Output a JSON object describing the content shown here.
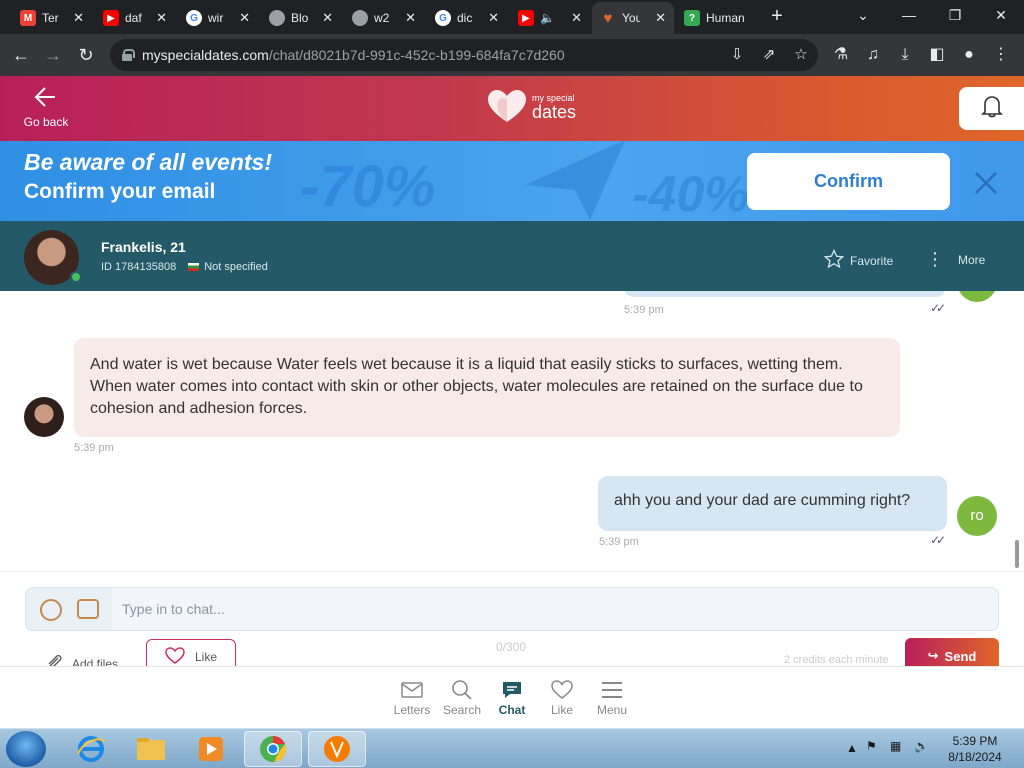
{
  "browser": {
    "tabs": [
      {
        "title": "Ter",
        "icon": "mail-icon",
        "color": "#ea4335"
      },
      {
        "title": "daf",
        "icon": "youtube-icon",
        "color": "#ff0000"
      },
      {
        "title": "wir",
        "icon": "google-icon",
        "color": "#4285f4"
      },
      {
        "title": "Blo",
        "icon": "globe-icon",
        "color": "#9aa0a6"
      },
      {
        "title": "w2",
        "icon": "globe-icon",
        "color": "#9aa0a6"
      },
      {
        "title": "dic",
        "icon": "google-icon",
        "color": "#4285f4"
      },
      {
        "title": "",
        "icon": "youtube-icon",
        "color": "#ff0000"
      },
      {
        "title": "You",
        "icon": "heart-icon",
        "color": "#e0662a"
      },
      {
        "title": "Human",
        "icon": "question-icon",
        "color": "#34a853"
      }
    ],
    "active_tab_index": 7,
    "url_domain": "myspecialdates.com",
    "url_path": "/chat/d8021b7d-991c-452c-b199-684fa7c7d260"
  },
  "header": {
    "back_label": "Go back",
    "logo_small": "my special",
    "logo_big": "dates"
  },
  "banner": {
    "line1": "Be aware of all events!",
    "line2": "Confirm your email",
    "confirm_label": "Confirm",
    "deco1": "-70%",
    "deco2": "-40%"
  },
  "profile": {
    "name": "Frankelis, 21",
    "id_text": "ID 1784135808",
    "location": "Not specified",
    "favorite_label": "Favorite",
    "more_label": "More"
  },
  "chat": {
    "prev_time": "5:39 pm",
    "incoming": {
      "text": "And water is wet because Water feels wet because it is a liquid that easily sticks to surfaces, wetting them. When water comes into contact with skin or other objects, water molecules are retained on the surface due to cohesion and adhesion forces.",
      "time": "5:39 pm"
    },
    "outgoing": {
      "text": "ahh you and your dad are cumming right?",
      "time": "5:39 pm",
      "avatar_initials": "ro"
    }
  },
  "composer": {
    "placeholder": "Type in to chat...",
    "add_files_label": "Add files",
    "like_label": "Like",
    "counter": "0/300",
    "credits_text": "2 credits each minute",
    "send_label": "Send"
  },
  "bottom_nav": [
    {
      "label": "Letters",
      "icon": "envelope-icon"
    },
    {
      "label": "Search",
      "icon": "search-icon"
    },
    {
      "label": "Chat",
      "icon": "chat-icon",
      "active": true
    },
    {
      "label": "Like",
      "icon": "heart-icon"
    },
    {
      "label": "Menu",
      "icon": "menu-icon"
    }
  ],
  "taskbar": {
    "time": "5:39 PM",
    "date": "8/18/2024"
  },
  "colors": {
    "brand_gradient_start": "#b81f5a",
    "brand_gradient_end": "#e0662a",
    "profile_bar": "#245a68",
    "banner_blue": "#3f98ea",
    "incoming_bubble": "#f8eae8",
    "outgoing_bubble": "#d6e6f2"
  }
}
